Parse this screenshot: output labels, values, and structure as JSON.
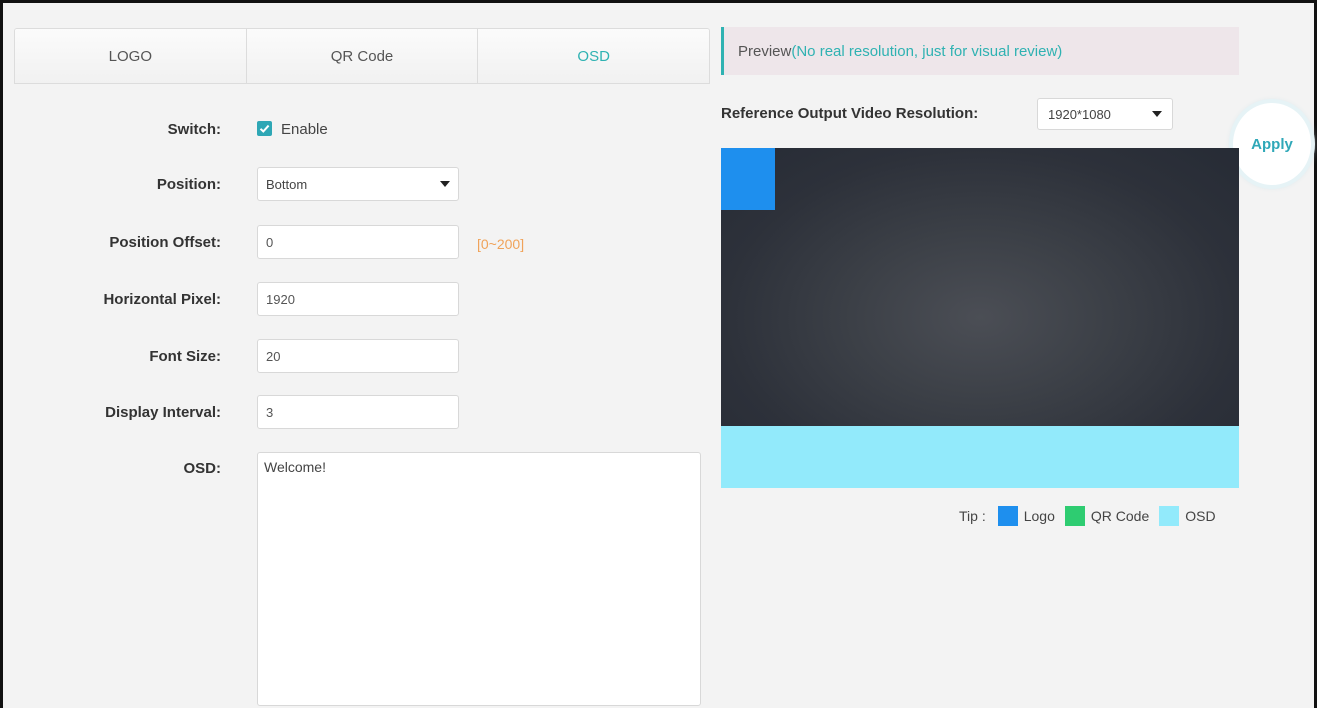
{
  "tabs": [
    {
      "label": "LOGO",
      "active": false
    },
    {
      "label": "QR Code",
      "active": false
    },
    {
      "label": "OSD",
      "active": true
    }
  ],
  "form": {
    "switch_label": "Switch:",
    "switch_checkbox_label": "Enable",
    "switch_checked": true,
    "position_label": "Position:",
    "position_value": "Bottom",
    "position_offset_label": "Position Offset:",
    "position_offset_value": "0",
    "position_offset_hint": "[0~200]",
    "horizontal_pixel_label": "Horizontal Pixel:",
    "horizontal_pixel_value": "1920",
    "font_size_label": "Font Size:",
    "font_size_value": "20",
    "display_interval_label": "Display Interval:",
    "display_interval_value": "3",
    "osd_label": "OSD:",
    "osd_value": "Welcome!"
  },
  "preview": {
    "title": "Preview",
    "note": "(No real resolution, just for visual review)",
    "resolution_label": "Reference Output Video Resolution:",
    "resolution_value": "1920*1080",
    "apply_label": "Apply"
  },
  "legend": {
    "tip_label": "Tip :",
    "items": [
      {
        "label": "Logo",
        "color": "#1e8fee"
      },
      {
        "label": "QR Code",
        "color": "#2ecc71"
      },
      {
        "label": "OSD",
        "color": "#92eafb"
      }
    ]
  },
  "colors": {
    "accent": "#2fb2b2",
    "hint": "#f0a35a",
    "checkbox": "#2ea7b5"
  }
}
